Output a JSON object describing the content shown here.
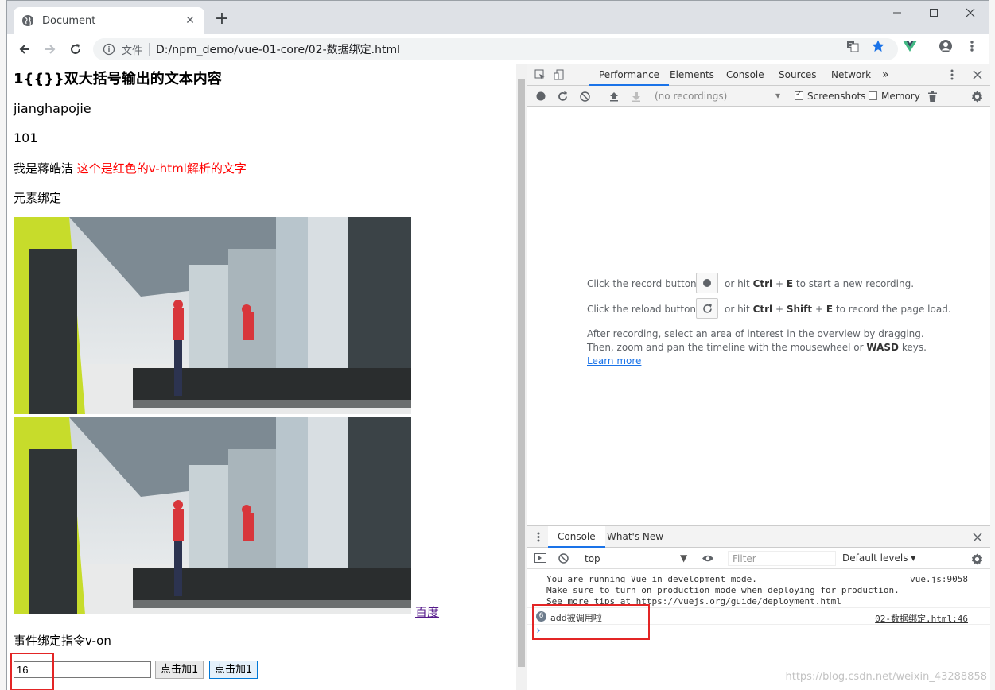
{
  "tab": {
    "title": "Document"
  },
  "omnibox": {
    "scheme_label": "文件",
    "url": "D:/npm_demo/vue-01-core/02-数据绑定.html"
  },
  "page": {
    "heading": "1{{}}双大括号输出的文本内容",
    "line_name": "jianghapojie",
    "line_number": "101",
    "line_intro": "我是蒋皓洁",
    "line_red": "这个是红色的v-html解析的文字",
    "line_bind": "元素绑定",
    "link_text": "百度",
    "event_label": "事件绑定指令v-on",
    "input_value": "16",
    "button1": "点击加1",
    "button2": "点击加1"
  },
  "devtools": {
    "tabs": [
      "Performance",
      "Elements",
      "Console",
      "Sources",
      "Network"
    ],
    "more": "»",
    "recordings_placeholder": "(no recordings)",
    "screenshots_label": "Screenshots",
    "memory_label": "Memory",
    "perf_help": {
      "l1a": "Click the record button",
      "l1b": "or hit",
      "l1k1": "Ctrl",
      "l1p": "+",
      "l1k2": "E",
      "l1c": "to start a new recording.",
      "l2a": "Click the reload button",
      "l2b": "or hit",
      "l2k1": "Ctrl",
      "l2p1": "+",
      "l2k2": "Shift",
      "l2p2": "+",
      "l2k3": "E",
      "l2c": "to record the page load.",
      "l3": "After recording, select an area of interest in the overview by dragging.",
      "l4a": "Then, zoom and pan the timeline with the mousewheel or",
      "l4k": "WASD",
      "l4b": "keys.",
      "learn_more": "Learn more"
    },
    "drawer_tabs": [
      "Console",
      "What's New"
    ],
    "context": "top",
    "filter_placeholder": "Filter",
    "levels": "Default levels ▾",
    "messages": [
      {
        "text": "You are running Vue in development mode.",
        "src": "vue.js:9058"
      },
      {
        "text": "Make sure to turn on production mode when deploying for production."
      },
      {
        "text": "See more tips at https://vuejs.org/guide/deployment.html"
      }
    ],
    "log": {
      "count": "6",
      "text": "add被调用啦",
      "src": "02-数据绑定.html:46"
    },
    "prompt": "›"
  },
  "watermark": "https://blog.csdn.net/weixin_43288858",
  "colors": {
    "accent": "#1a73e8",
    "annotation_red": "#e32525",
    "v_html_red": "#ff0000",
    "vue_green": "#41b883"
  }
}
